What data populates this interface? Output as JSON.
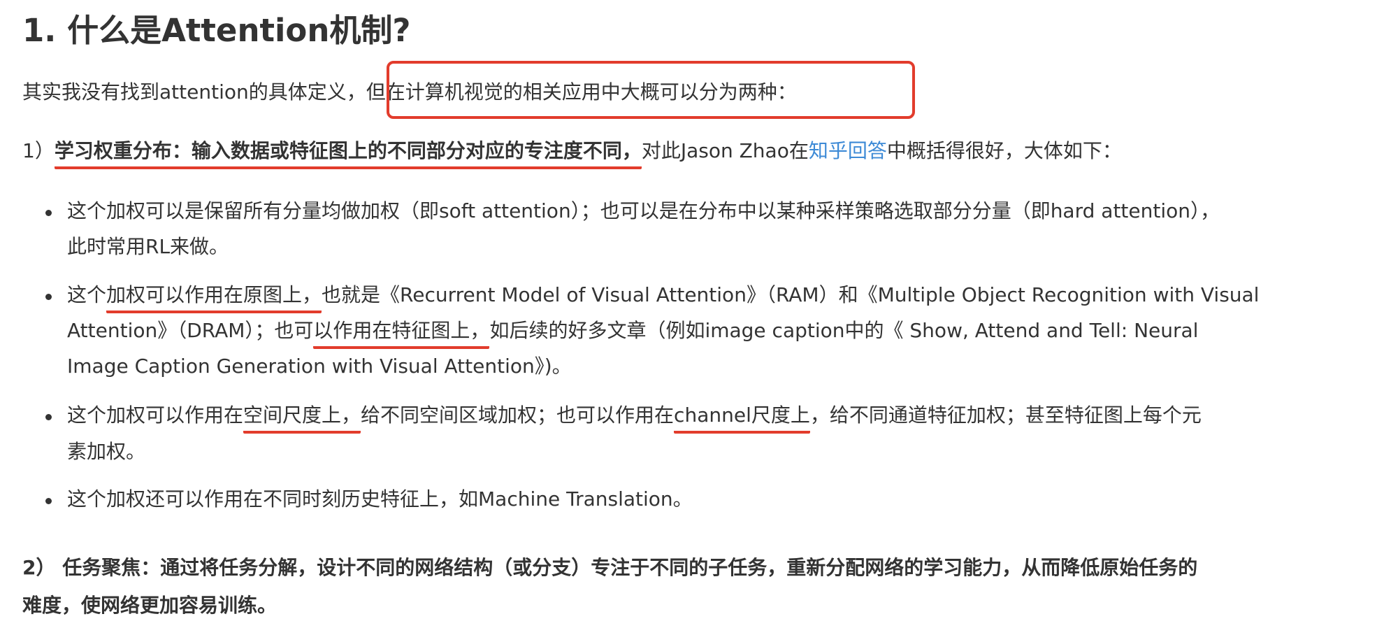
{
  "heading": "1. 什么是Attention机制?",
  "intro": {
    "part1": "其实我没有找到attention的具体定义，",
    "part2": "但在计算机视觉的相关应用中大概可以分为两种："
  },
  "point1": {
    "prefix": "1）",
    "bold": "学习权重分布：输入数据或特征图上的不同部分对应的专注度不同，",
    "text1": "对此Jason Zhao在",
    "link": "知乎回答",
    "text2": "中概括得很好，大体如下："
  },
  "bullets": [
    {
      "l1": "这个加权可以是保留所有分量均做加权（即soft attention）；也可以是在分布中以某种采样策略选取部分分量（即hard attention），",
      "l2": "此时常用RL来做。"
    },
    {
      "l1a": "这个",
      "l1u": "加权可以作用在原图上，",
      "l1b": "也就是《Recurrent Model of Visual Attention》（RAM）和《Multiple Object Recognition with Visual",
      "l2a": "Attention》（DRAM）；也可",
      "l2u": "以作用在特征图上，",
      "l2b": "如后续的好多文章（例如image caption中的《 Show, Attend and Tell: Neural",
      "l3": "Image Caption Generation with Visual Attention》)。"
    },
    {
      "l1a": "这个加权可以作用在",
      "l1u1": "空间尺度上，",
      "l1b": "给不同空间区域加权；也可以作用在",
      "l1u2": "channel尺度上",
      "l1c": "，给不同通道特征加权；甚至特征图上每个元",
      "l2": "素加权。"
    },
    {
      "l1": "这个加权还可以作用在不同时刻历史特征上，如Machine Translation。"
    }
  ],
  "point2": {
    "l1": "2） 任务聚焦：通过将任务分解，设计不同的网络结构（或分支）专注于不同的子任务，重新分配网络的学习能力，从而降低原始任务的",
    "l2": "难度，使网络更加容易训练。"
  },
  "accent_color": "#e23c2c",
  "link_color": "#3d8ad6"
}
